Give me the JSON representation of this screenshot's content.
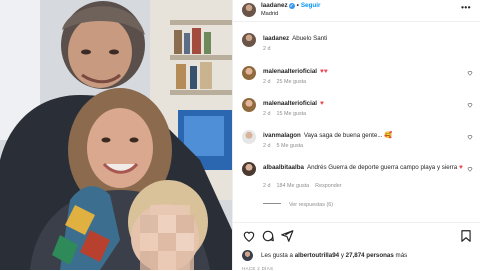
{
  "header": {
    "username": "laadanez",
    "follow_label": "Seguir",
    "separator": "•",
    "location": "Madrid",
    "more_label": "•••"
  },
  "caption": {
    "username": "laadanez",
    "text": "Abuelo Santi",
    "time": "2 d"
  },
  "comments": [
    {
      "username": "malenaalterioficial",
      "text": "",
      "emoji": "♥♥",
      "time": "2 d",
      "likes": "25 Me gusta",
      "reply": ""
    },
    {
      "username": "malenaalterioficial",
      "text": "",
      "emoji": "♥",
      "time": "2 d",
      "likes": "15 Me gusta",
      "reply": ""
    },
    {
      "username": "ivanmalagon",
      "text": "Vaya saga de buena gente...",
      "emoji": "🥰",
      "time": "2 d",
      "likes": "5 Me gusta",
      "reply": ""
    },
    {
      "username": "albaalbitaalba",
      "text": "Andrés Guerra de deporte guerra campo playa y sierra",
      "emoji": "♥",
      "time": "2 d",
      "likes": "184 Me gusta",
      "reply": "Responder"
    }
  ],
  "view_replies": "Ver respuestas (6)",
  "likes_line": {
    "prefix": "Les gusta a",
    "user": "albertoutrilla94",
    "connector": "y",
    "count": "27,874 personas",
    "suffix": "más"
  },
  "post_date": "HACE 2 DÍAS",
  "icons": [
    "heart-icon",
    "comment-icon",
    "share-icon",
    "bookmark-icon",
    "more-icon",
    "verified-icon"
  ],
  "colors": {
    "accent": "#0095f6",
    "verified": "#3897f0",
    "heart": "#ed4956",
    "muted": "#8e8e8e"
  }
}
